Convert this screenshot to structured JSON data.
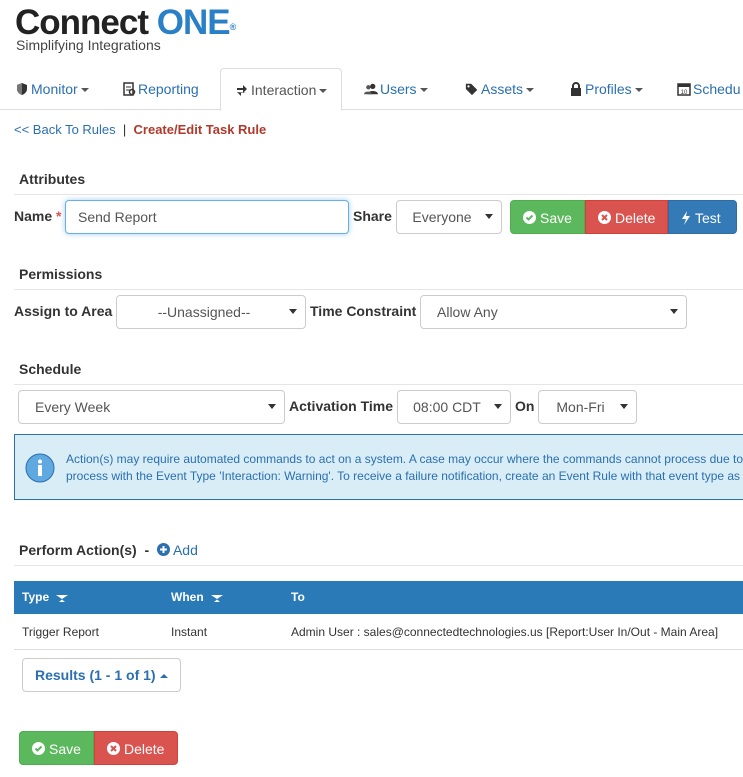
{
  "logo": {
    "name": "Connect",
    "name_accent": "ONE",
    "reg": "®",
    "tagline": "Simplifying Integrations"
  },
  "nav": {
    "items": [
      {
        "label": "Monitor",
        "icon": "shield-icon"
      },
      {
        "label": "Reporting",
        "icon": "report-icon"
      },
      {
        "label": "Interaction",
        "icon": "interaction-icon"
      },
      {
        "label": "Users",
        "icon": "users-icon"
      },
      {
        "label": "Assets",
        "icon": "tags-icon"
      },
      {
        "label": "Profiles",
        "icon": "lock-icon"
      },
      {
        "label": "Schedu",
        "icon": "calendar-icon"
      }
    ]
  },
  "breadcrumb": {
    "back": "<< Back To Rules",
    "sep": "|",
    "current": "Create/Edit Task Rule"
  },
  "attributes": {
    "title": "Attributes",
    "name_label": "Name",
    "required_mark": "*",
    "name_value": "Send Report",
    "share_label": "Share",
    "share_value": "Everyone",
    "save": "Save",
    "delete": "Delete",
    "test": "Test"
  },
  "permissions": {
    "title": "Permissions",
    "area_label": "Assign to Area",
    "area_value": "--Unassigned--",
    "time_label": "Time Constraint",
    "time_value": "Allow Any"
  },
  "schedule": {
    "title": "Schedule",
    "frequency": "Every Week",
    "activation_label": "Activation Time",
    "activation_value": "08:00 CDT",
    "on_label": "On",
    "on_value": "Mon-Fri"
  },
  "alert": {
    "line1": "Action(s) may require automated commands to act on a system. A case may occur where the commands cannot process due to",
    "line2": "process with the Event Type 'Interaction: Warning'. To receive a failure notification, create an Event Rule with that event type as"
  },
  "actions": {
    "title": "Perform Action(s)",
    "dash": "-",
    "add": "Add",
    "columns": [
      "Type",
      "When",
      "To"
    ],
    "rows": [
      {
        "type": "Trigger Report",
        "when": "Instant",
        "to": "Admin User : sales@connectedtechnologies.us [Report:User In/Out - Main Area]"
      }
    ],
    "results": "Results (1 - 1 of 1)"
  },
  "footer": {
    "save": "Save",
    "delete": "Delete"
  },
  "colors": {
    "primary": "#2a7ab8",
    "success": "#5cb85c",
    "danger": "#d9534f",
    "link": "#2a6fb0"
  }
}
